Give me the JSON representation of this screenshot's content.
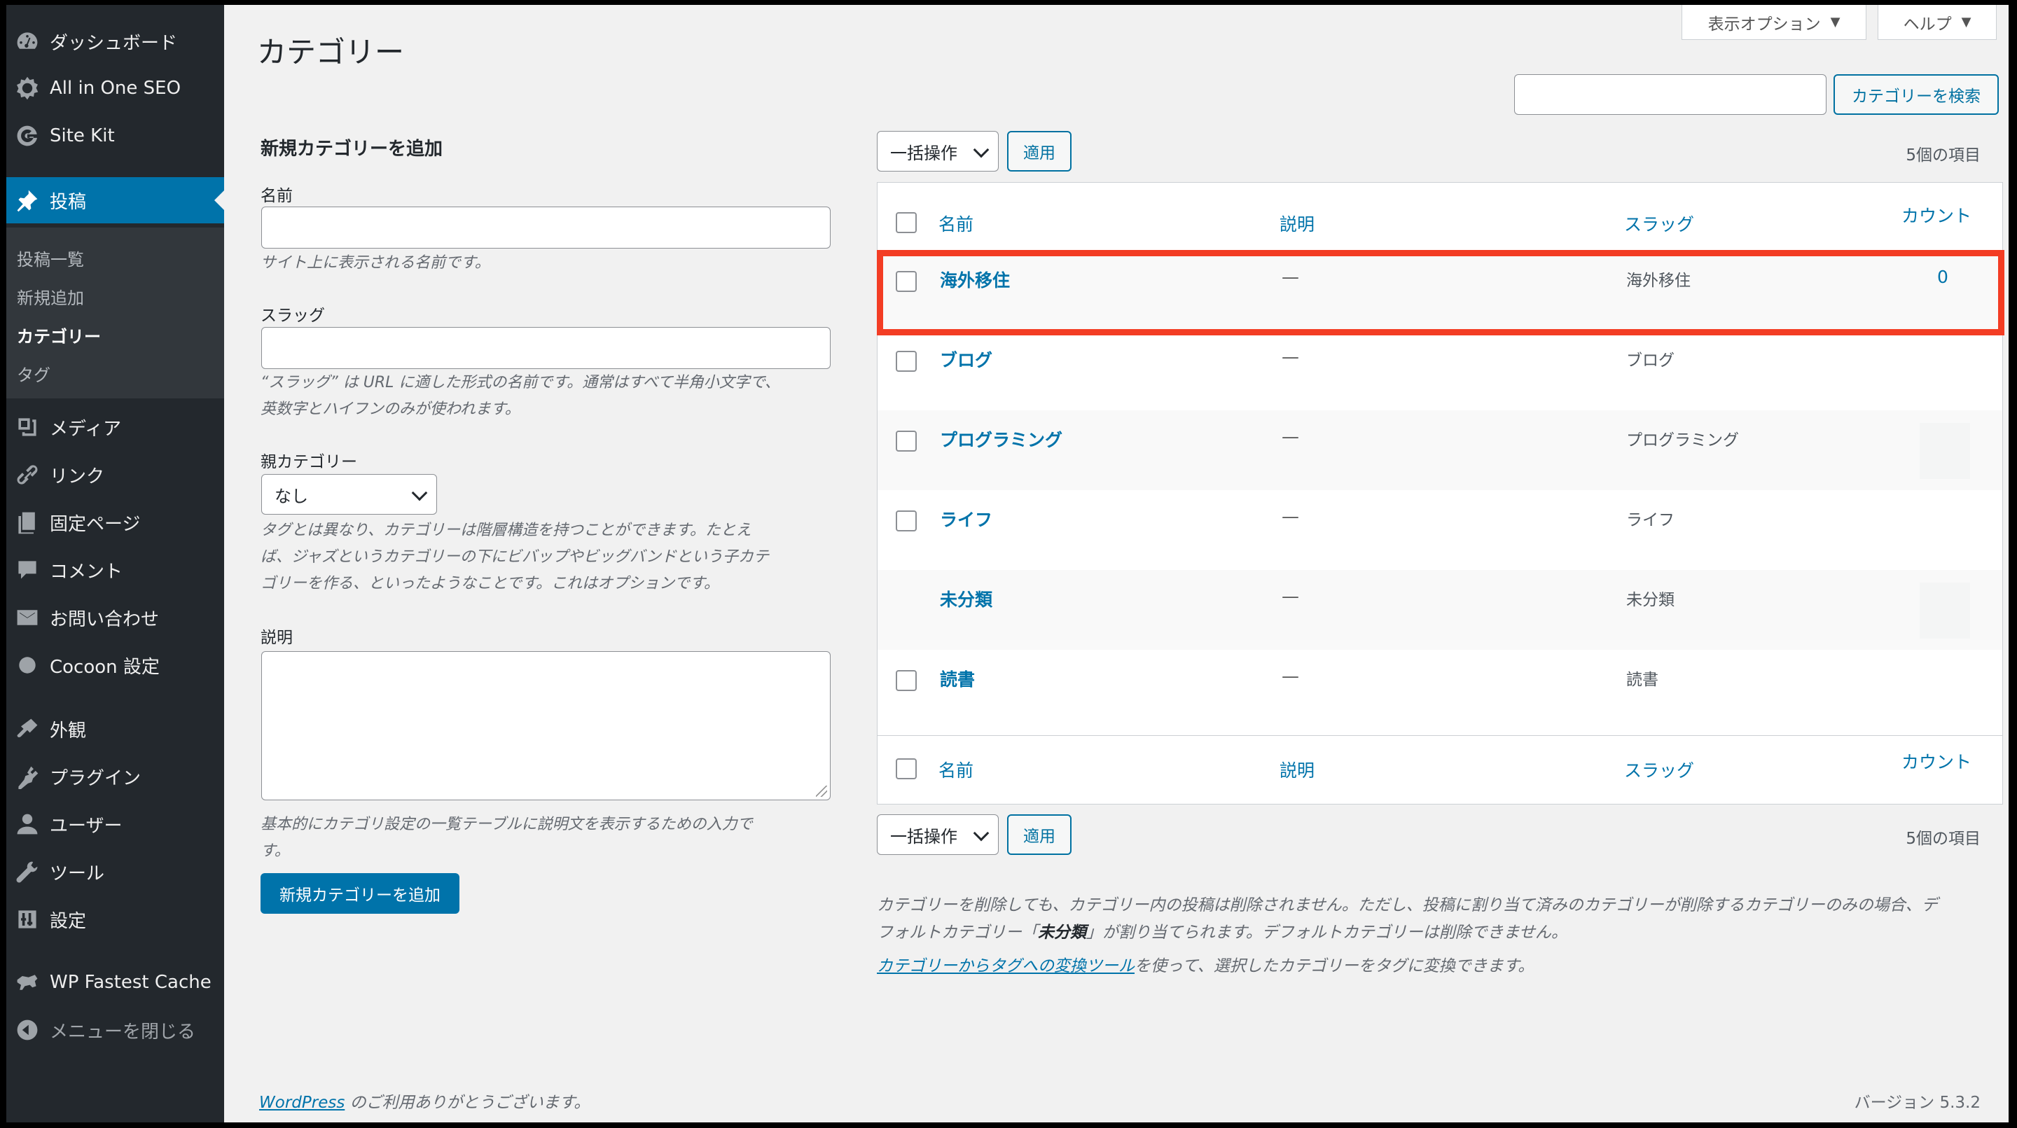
{
  "sidebar": {
    "items": [
      {
        "label": "ダッシュボード",
        "icon": "dashboard-icon"
      },
      {
        "label": "All in One SEO",
        "icon": "gear-icon"
      },
      {
        "label": "Site Kit",
        "icon": "google-g-icon"
      },
      {
        "label": "投稿",
        "icon": "pin-icon"
      },
      {
        "label": "メディア",
        "icon": "media-icon"
      },
      {
        "label": "リンク",
        "icon": "link-icon"
      },
      {
        "label": "固定ページ",
        "icon": "page-icon"
      },
      {
        "label": "コメント",
        "icon": "comment-icon"
      },
      {
        "label": "お問い合わせ",
        "icon": "mail-icon"
      },
      {
        "label": "Cocoon 設定",
        "icon": "circle-icon"
      },
      {
        "label": "外観",
        "icon": "brush-icon"
      },
      {
        "label": "プラグイン",
        "icon": "plugin-icon"
      },
      {
        "label": "ユーザー",
        "icon": "user-icon"
      },
      {
        "label": "ツール",
        "icon": "wrench-icon"
      },
      {
        "label": "設定",
        "icon": "settings-icon"
      },
      {
        "label": "WP Fastest Cache",
        "icon": "cheetah-icon"
      },
      {
        "label": "メニューを閉じる",
        "icon": "collapse-icon"
      }
    ],
    "submenu": [
      "投稿一覧",
      "新規追加",
      "カテゴリー",
      "タグ"
    ],
    "accent": "#0073aa"
  },
  "header": {
    "title": "カテゴリー",
    "screen_options": "表示オプション",
    "help": "ヘルプ",
    "search_button": "カテゴリーを検索"
  },
  "form": {
    "title": "新規カテゴリーを追加",
    "name_label": "名前",
    "name_desc": "サイト上に表示される名前です。",
    "slug_label": "スラッグ",
    "slug_desc_1": "“スラッグ” は URL に適した形式の名前です。通常はすべて半角小文字で、",
    "slug_desc_2": "英数字とハイフンのみが使われます。",
    "parent_label": "親カテゴリー",
    "parent_value": "なし",
    "parent_desc_1": "タグとは異なり、カテゴリーは階層構造を持つことができます。たとえ",
    "parent_desc_2": "ば、ジャズというカテゴリーの下にビバップやビッグバンドという子カテ",
    "parent_desc_3": "ゴリーを作る、といったようなことです。これはオプションです。",
    "desc_label": "説明",
    "desc_desc_1": "基本的にカテゴリ設定の一覧テーブルに説明文を表示するための入力で",
    "desc_desc_2": "す。",
    "submit": "新規カテゴリーを追加"
  },
  "table": {
    "bulk_action": "一括操作",
    "apply": "適用",
    "items_count": "5個の項目",
    "columns": {
      "name": "名前",
      "description": "説明",
      "slug": "スラッグ",
      "count": "カウント"
    },
    "rows": [
      {
        "name": "海外移住",
        "description": "—",
        "slug": "海外移住",
        "count": "0"
      },
      {
        "name": "ブログ",
        "description": "—",
        "slug": "ブログ",
        "count": ""
      },
      {
        "name": "プログラミング",
        "description": "—",
        "slug": "プログラミング",
        "count": ""
      },
      {
        "name": "ライフ",
        "description": "—",
        "slug": "ライフ",
        "count": ""
      },
      {
        "name": "未分類",
        "description": "—",
        "slug": "未分類",
        "count": ""
      },
      {
        "name": "読書",
        "description": "—",
        "slug": "読書",
        "count": ""
      }
    ]
  },
  "notes": {
    "line1": "カテゴリーを削除しても、カテゴリー内の投稿は削除されません。ただし、投稿に割り当て済みのカテゴリーが削除するカテゴリーのみの場合、デ",
    "line2_a": "フォルトカテゴリー「",
    "line2_b": "未分類",
    "line2_c": "」が割り当てられます。デフォルトカテゴリーは削除できません。",
    "line3_link": "カテゴリーからタグへの変換ツール",
    "line3_rest": "を使って、選択したカテゴリーをタグに変換できます。"
  },
  "footer": {
    "link": "WordPress",
    "thanks": " のご利用ありがとうございます。",
    "version": "バージョン 5.3.2"
  },
  "highlight_color": "#f33d24"
}
